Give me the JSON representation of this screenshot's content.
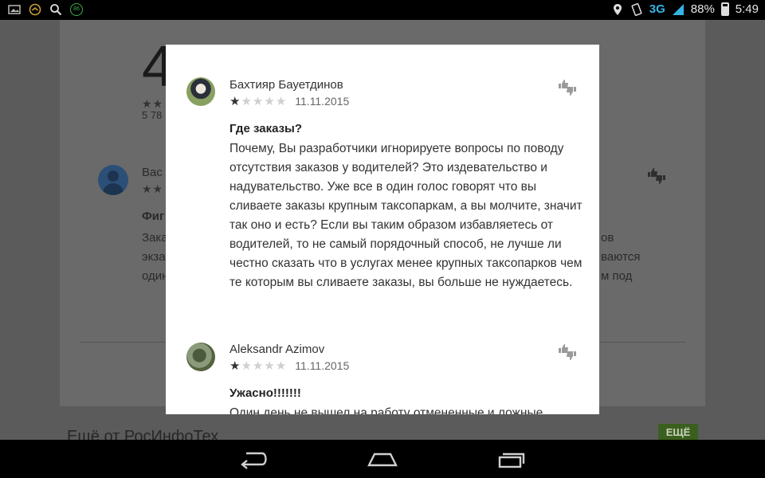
{
  "status_bar": {
    "network": "3G",
    "battery": "88%",
    "time": "5:49",
    "badge": "86"
  },
  "background": {
    "rating_big": "4",
    "review_count": "5 78",
    "reviewer_partial": "Вас",
    "title_partial": "Фиг",
    "lines_left": [
      "Зака",
      "экза",
      "один"
    ],
    "lines_right": [
      "ов",
      "ваются",
      "м под"
    ],
    "section_title": "Ещё от РосИнфоТех",
    "more_button": "ЕЩЁ"
  },
  "dialog": {
    "reviews": [
      {
        "author": "Бахтияр Бауетдинов",
        "rating": 1,
        "date": "11.11.2015",
        "title": "Где заказы?",
        "body": "Почему, Вы разработчики игнорируете вопросы по поводу отсутствия заказов у водителей? Это издевательство и надувательство. Уже все в один голос говорят что вы сливаете заказы крупным таксопаркам, а вы молчите, значит так оно и есть? Если вы таким образом избавляетесь от водителей, то не самый порядочный способ, не лучше ли честно сказать что в услугах менее крупных таксопарков чем те которым вы сливаете заказы, вы больше не нуждаетесь."
      },
      {
        "author": "Aleksandr Azimov",
        "rating": 1,
        "date": "11.11.2015",
        "title": "Ужасно!!!!!!!",
        "body": "Один день не вышел на работу отмененные и ложные"
      }
    ]
  }
}
